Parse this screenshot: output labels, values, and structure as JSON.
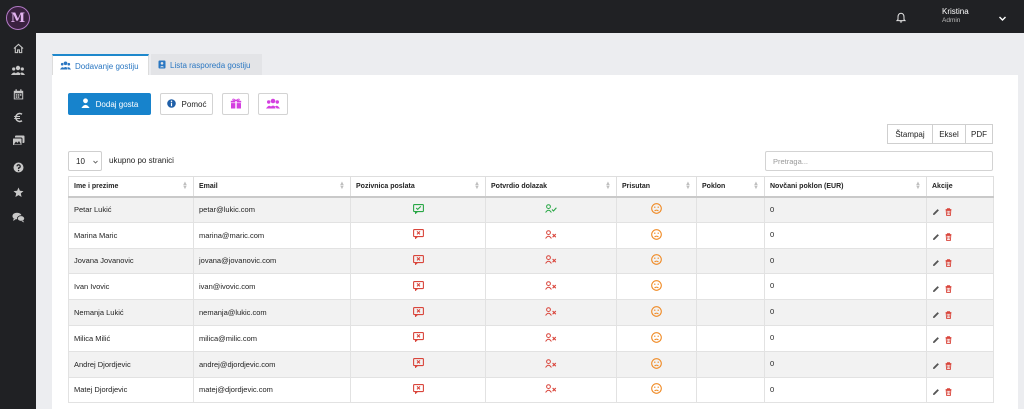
{
  "app": {
    "logo_text": "M"
  },
  "user": {
    "name": "Kristina",
    "role": "Admin"
  },
  "sidebar": {
    "icons": [
      "home-icon",
      "guests-icon",
      "calendar-icon",
      "euro-icon",
      "gallery-icon",
      "help-icon",
      "star-icon",
      "chat-icon"
    ]
  },
  "tabs": [
    {
      "label": "Dodavanje gostiju",
      "icon": "users-icon",
      "active": true
    },
    {
      "label": "Lista rasporeda gostiju",
      "icon": "list-icon",
      "active": false
    }
  ],
  "toolbar": {
    "add_guest_label": "Dodaj gosta",
    "help_label": "Pomoć",
    "gift_icon": "gift-icon",
    "group_icon": "group-icon"
  },
  "export": {
    "print": "Štampaj",
    "excel": "Eksel",
    "pdf": "PDF"
  },
  "table_controls": {
    "page_size": "10",
    "page_size_label": "ukupno po stranici",
    "search_placeholder": "Pretraga..."
  },
  "table": {
    "columns": [
      "Ime i prezime",
      "Email",
      "Pozivnica poslata",
      "Potvrdio dolazak",
      "Prisutan",
      "Poklon",
      "Novčani poklon (EUR)",
      "Akcije"
    ],
    "rows": [
      {
        "name": "Petar Lukić",
        "email": "petar@lukic.com",
        "invitation_sent": true,
        "confirmed": true,
        "present": "sad-face-icon",
        "gift": "",
        "money": "0"
      },
      {
        "name": "Marina Maric",
        "email": "marina@maric.com",
        "invitation_sent": false,
        "confirmed": false,
        "present": "sad-face-icon",
        "gift": "",
        "money": "0"
      },
      {
        "name": "Jovana Jovanovic",
        "email": "jovana@jovanovic.com",
        "invitation_sent": false,
        "confirmed": false,
        "present": "sad-face-icon",
        "gift": "",
        "money": "0"
      },
      {
        "name": "Ivan Ivovic",
        "email": "ivan@ivovic.com",
        "invitation_sent": false,
        "confirmed": false,
        "present": "sad-face-icon",
        "gift": "",
        "money": "0"
      },
      {
        "name": "Nemanja Lukić",
        "email": "nemanja@lukic.com",
        "invitation_sent": false,
        "confirmed": false,
        "present": "sad-face-icon",
        "gift": "",
        "money": "0"
      },
      {
        "name": "Milica Milić",
        "email": "milica@milic.com",
        "invitation_sent": false,
        "confirmed": false,
        "present": "sad-face-icon",
        "gift": "",
        "money": "0"
      },
      {
        "name": "Andrej Djordjevic",
        "email": "andrej@djordjevic.com",
        "invitation_sent": false,
        "confirmed": false,
        "present": "sad-face-icon",
        "gift": "",
        "money": "0"
      },
      {
        "name": "Matej Djordjevic",
        "email": "matej@djordjevic.com",
        "invitation_sent": false,
        "confirmed": false,
        "present": "sad-face-icon",
        "gift": "",
        "money": "0"
      }
    ]
  },
  "colors": {
    "primary": "#1783cc",
    "success": "#28a745",
    "danger": "#d9453b",
    "warning": "#f08a24",
    "accent_purple": "#d43fe0"
  }
}
